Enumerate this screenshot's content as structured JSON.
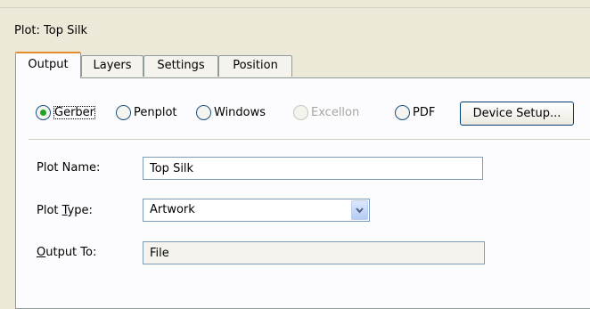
{
  "dialog": {
    "title": "Plot: Top Silk"
  },
  "tabs": [
    {
      "label": "Output",
      "active": true
    },
    {
      "label": "Layers",
      "active": false
    },
    {
      "label": "Settings",
      "active": false
    },
    {
      "label": "Position",
      "active": false
    }
  ],
  "plot_format": {
    "options": [
      {
        "label": "Gerber",
        "selected": true,
        "enabled": true
      },
      {
        "label": "Penplot",
        "selected": false,
        "enabled": true
      },
      {
        "label": "Windows",
        "selected": false,
        "enabled": true
      },
      {
        "label": "Excellon",
        "selected": false,
        "enabled": false
      },
      {
        "label": "PDF",
        "selected": false,
        "enabled": true
      }
    ],
    "device_setup_label": "Device Setup..."
  },
  "fields": {
    "plot_name": {
      "label": "Plot Name:",
      "value": "Top Silk"
    },
    "plot_type": {
      "label_pre": "Plot ",
      "label_mnemonic": "T",
      "label_post": "ype:",
      "value": "Artwork"
    },
    "output_to": {
      "label_mnemonic": "O",
      "label_post": "utput To:",
      "value": "File"
    }
  },
  "colors": {
    "dialog_background": "#ece9d8",
    "panel_background": "#fcfcfe",
    "active_tab_accent": "#e68b2c",
    "radio_selected_dot": "#21a121",
    "disabled_text": "#a7a69e"
  }
}
